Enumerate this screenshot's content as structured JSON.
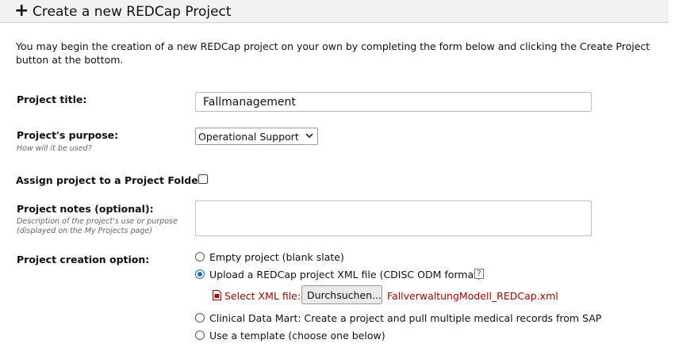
{
  "header": {
    "icon": "plus-icon",
    "title": "Create a new REDCap Project"
  },
  "intro": "You may begin the creation of a new REDCap project on your own by completing the form below and clicking the Create Project button at the bottom.",
  "form": {
    "title_label": "Project title:",
    "title_value": "Fallmanagement",
    "purpose_label": "Project's purpose:",
    "purpose_hint": "How will it be used?",
    "purpose_selected": "Operational Support",
    "folder_label": "Assign project to a Project Folder?",
    "folder_checked": false,
    "notes_label": "Project notes (optional):",
    "notes_hint_line1": "Description of the project's use or purpose",
    "notes_hint_line2": "(displayed on the My Projects page)",
    "notes_value": "",
    "creation_label": "Project creation option:",
    "options": [
      {
        "label": "Empty project (blank slate)",
        "checked": false
      },
      {
        "label": "Upload a REDCap project XML file (CDISC ODM format)",
        "checked": true
      },
      {
        "label": "Clinical Data Mart: Create a project and pull multiple medical records from SAP",
        "checked": false
      },
      {
        "label": "Use a template (choose one below)",
        "checked": false
      }
    ],
    "help_label": "?",
    "xml_label": "Select XML file:",
    "browse_label": "Durchsuchen...",
    "file_name": "FallverwaltungModell_REDCap.xml"
  },
  "colors": {
    "accent": "#1a6ccc",
    "file_red": "#b00000",
    "header_bg": "#f2f2f2"
  }
}
